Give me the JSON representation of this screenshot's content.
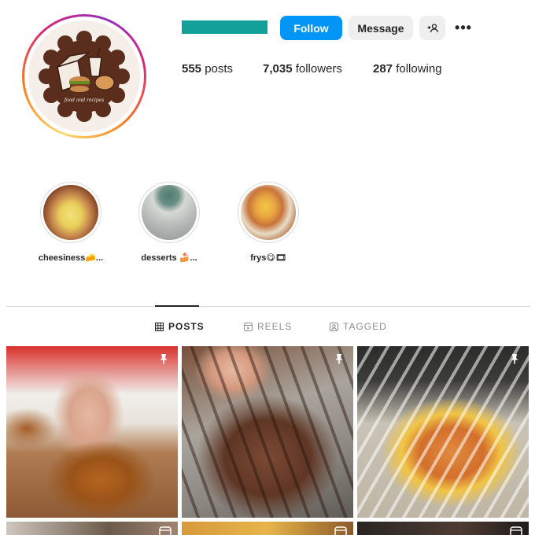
{
  "profile": {
    "follow_label": "Follow",
    "message_label": "Message",
    "more_label": "•••",
    "logo_text": "food and recipes"
  },
  "stats": {
    "posts_count": "555",
    "posts_label": "posts",
    "followers_count": "7,035",
    "followers_label": "followers",
    "following_count": "287",
    "following_label": "following"
  },
  "highlights": [
    {
      "label": "cheesiness🧀..."
    },
    {
      "label": "desserts 🍰..."
    },
    {
      "label": "frys😋🎞"
    }
  ],
  "tabs": [
    {
      "label": "POSTS",
      "active": true
    },
    {
      "label": "REELS",
      "active": false
    },
    {
      "label": "TAGGED",
      "active": false
    }
  ],
  "colors": {
    "follow_blue": "#0095f6",
    "handle_bar": "#12a09b",
    "button_gray": "#efefef"
  },
  "icons": {
    "pin": "pin-icon",
    "reel": "reel-icon",
    "grid": "grid-icon",
    "add_user": "add-user-icon"
  }
}
